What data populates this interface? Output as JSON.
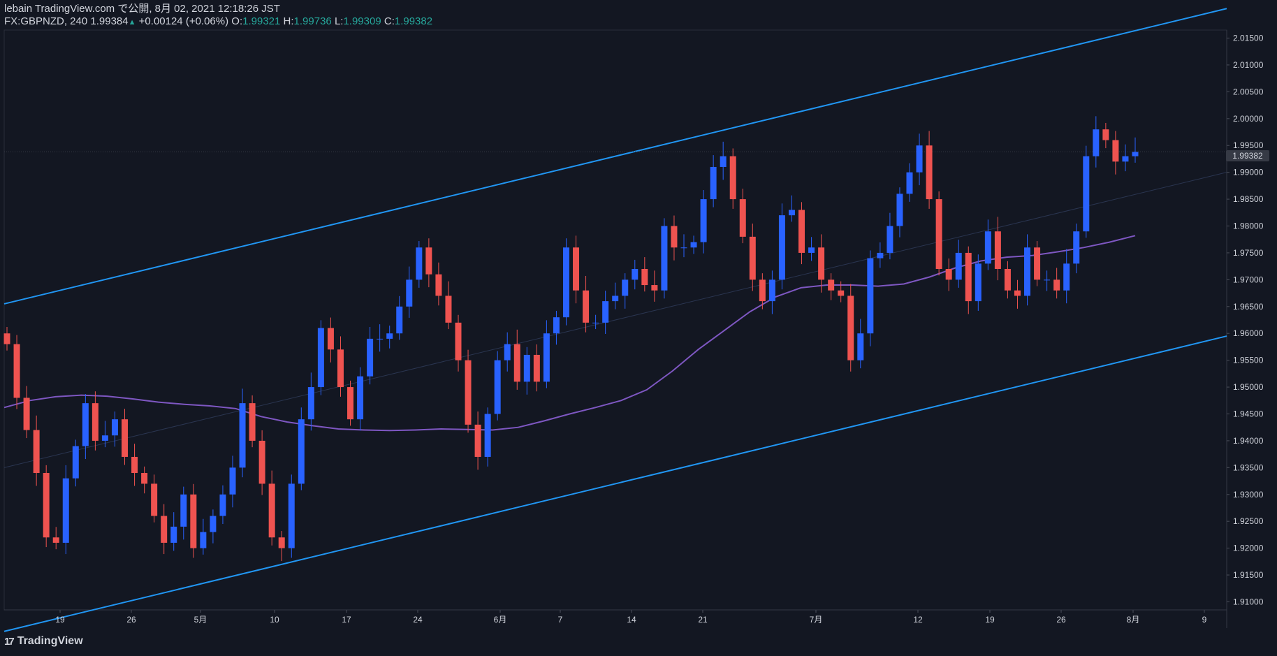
{
  "header": {
    "line1": "lebain TradingView.com で公開, 8月 02, 2021 12:18:26 JST",
    "symbol": "FX:GBPNZD, 240",
    "last": "1.99384",
    "change": "+0.00124 (+0.06%)",
    "o_label": "O:",
    "o_value": "1.99321",
    "h_label": "H:",
    "h_value": "1.99736",
    "l_label": "L:",
    "l_value": "1.99309",
    "c_label": "C:",
    "c_value": "1.99382"
  },
  "footer": {
    "brand": "TradingView",
    "logo_icon": "tradingview-logo-icon"
  },
  "current_price_label": "1.99382",
  "colors": {
    "background": "#131722",
    "up_candle": "#2962ff",
    "down_candle": "#ef5350",
    "channel": "#2196f3",
    "ma": "#7e57c2",
    "axis_text": "#d1d4dc",
    "header_value": "#26a69a"
  },
  "chart_data": {
    "type": "candlestick",
    "instrument": "FX:GBPNZD",
    "interval": "240",
    "y_axis": {
      "ticks": [
        "2.01500",
        "2.01000",
        "2.00500",
        "2.00000",
        "1.99500",
        "1.99000",
        "1.98500",
        "1.98000",
        "1.97500",
        "1.97000",
        "1.96500",
        "1.96000",
        "1.95500",
        "1.95000",
        "1.94500",
        "1.94000",
        "1.93500",
        "1.93000",
        "1.92500",
        "1.92000",
        "1.91500",
        "1.91000"
      ],
      "range": [
        1.9085,
        2.0165
      ]
    },
    "x_axis": {
      "ticks": [
        "19",
        "26",
        "5月",
        "10",
        "17",
        "24",
        "6月",
        "7",
        "14",
        "21",
        "7月",
        "12",
        "19",
        "26",
        "8月",
        "9"
      ]
    },
    "close_path": [
      1.958,
      1.948,
      1.942,
      1.934,
      1.922,
      1.921,
      1.933,
      1.939,
      1.947,
      1.94,
      1.941,
      1.944,
      1.937,
      1.934,
      1.932,
      1.926,
      1.921,
      1.924,
      1.93,
      1.92,
      1.923,
      1.926,
      1.93,
      1.935,
      1.947,
      1.94,
      1.932,
      1.922,
      1.92,
      1.932,
      1.944,
      1.95,
      1.961,
      1.957,
      1.95,
      1.944,
      1.952,
      1.959,
      1.959,
      1.96,
      1.965,
      1.97,
      1.976,
      1.971,
      1.967,
      1.962,
      1.955,
      1.943,
      1.937,
      1.945,
      1.955,
      1.958,
      1.951,
      1.956,
      1.951,
      1.96,
      1.963,
      1.976,
      1.968,
      1.962,
      1.962,
      1.966,
      1.967,
      1.97,
      1.972,
      1.969,
      1.968,
      1.98,
      1.976,
      1.976,
      1.977,
      1.985,
      1.991,
      1.993,
      1.985,
      1.978,
      1.97,
      1.966,
      1.97,
      1.982,
      1.983,
      1.975,
      1.976,
      1.97,
      1.968,
      1.967,
      1.955,
      1.96,
      1.974,
      1.975,
      1.98,
      1.986,
      1.99,
      1.995,
      1.985,
      1.972,
      1.97,
      1.975,
      1.966,
      1.973,
      1.979,
      1.972,
      1.968,
      1.967,
      1.976,
      1.97,
      1.97,
      1.968,
      1.973,
      1.979,
      1.993,
      1.998,
      1.996,
      1.992,
      1.993,
      1.9938
    ],
    "channel_upper": {
      "start": [
        0,
        1.9655
      ],
      "end": [
        1,
        2.0205
      ]
    },
    "channel_lower": {
      "start": [
        0,
        1.9045
      ],
      "end": [
        1,
        1.9595
      ]
    },
    "ma_path": [
      1.9462,
      1.9475,
      1.9482,
      1.9485,
      1.9483,
      1.9478,
      1.9472,
      1.9468,
      1.9465,
      1.946,
      1.9445,
      1.9435,
      1.9428,
      1.9422,
      1.942,
      1.9419,
      1.942,
      1.9422,
      1.9421,
      1.942,
      1.9425,
      1.9437,
      1.945,
      1.9462,
      1.9475,
      1.9495,
      1.953,
      1.957,
      1.9605,
      1.964,
      1.9668,
      1.9685,
      1.969,
      1.969,
      1.9688,
      1.9692,
      1.9705,
      1.9722,
      1.9735,
      1.9742,
      1.9745,
      1.9752,
      1.976,
      1.977,
      1.9782
    ],
    "last_price": 1.99382
  }
}
